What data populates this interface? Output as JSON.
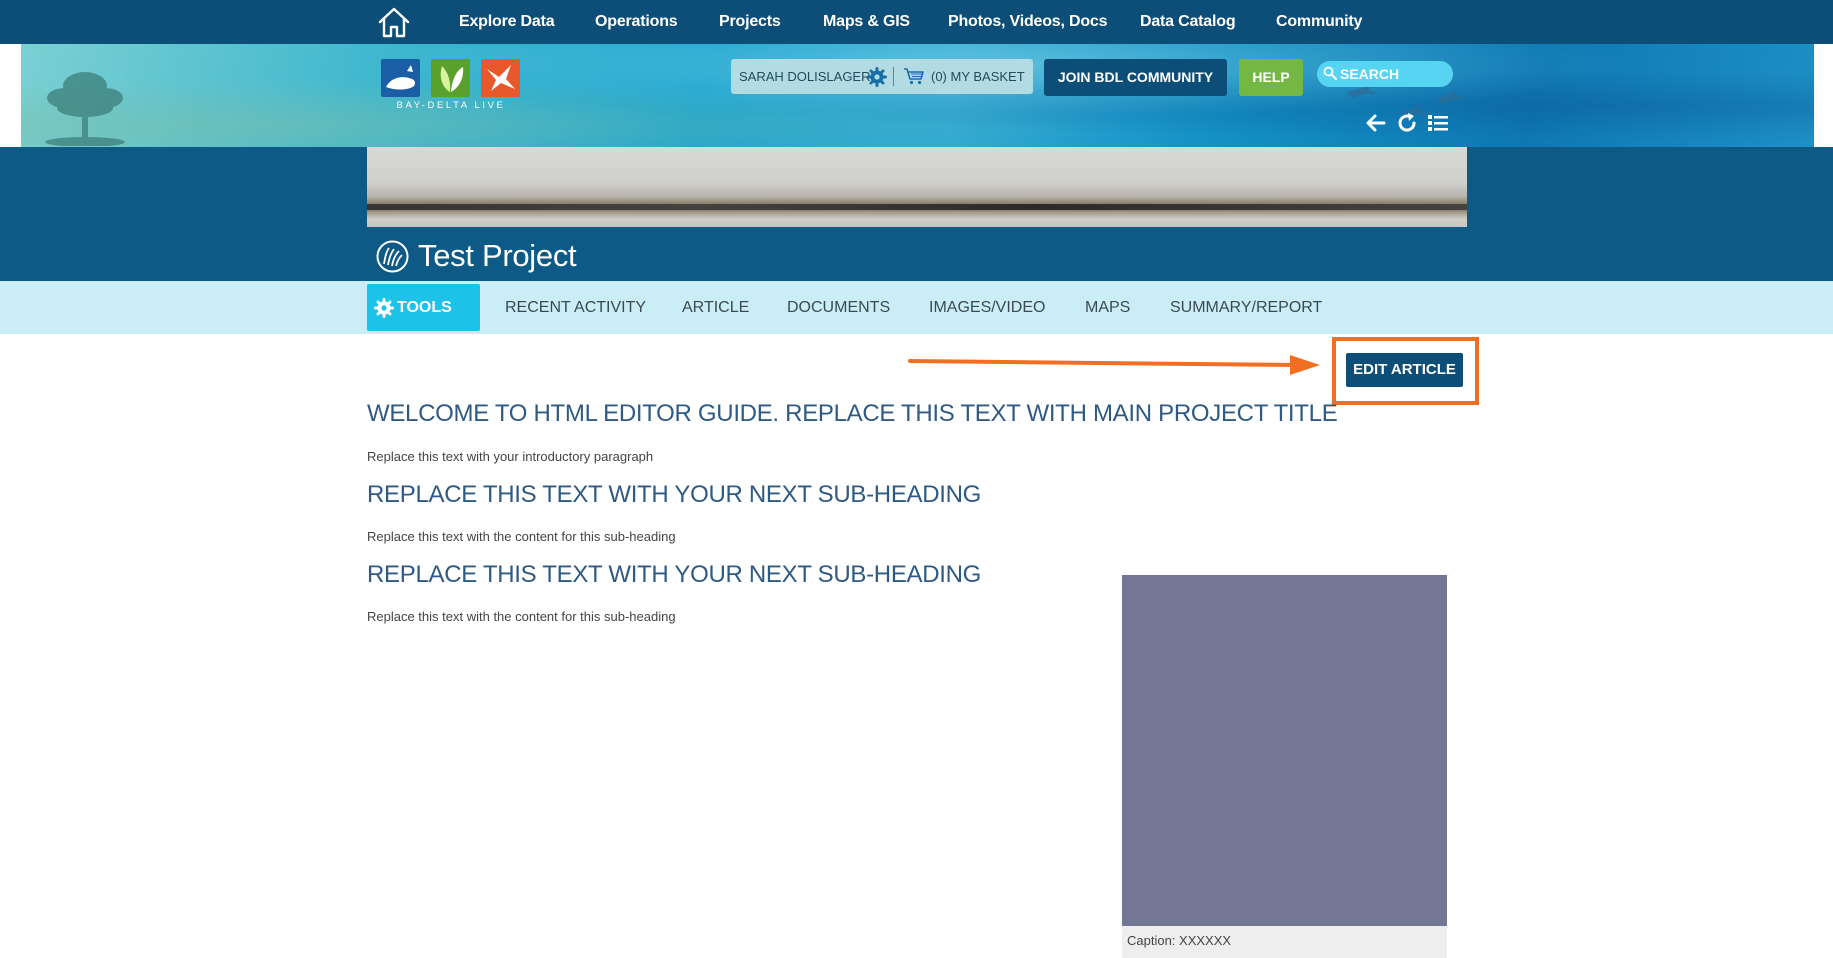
{
  "top_nav": {
    "home_icon": "home-icon",
    "links": [
      "Explore Data",
      "Operations",
      "Projects",
      "Maps & GIS",
      "Photos, Videos, Docs",
      "Data Catalog",
      "Community"
    ]
  },
  "header": {
    "logo_text": "BAY-DELTA LIVE",
    "logo_colors": [
      "#1a5fa6",
      "#5aa02c",
      "#e8582b"
    ],
    "user_name": "SARAH DOLISLAGER",
    "basket_label": "(0) MY BASKET",
    "join_label": "JOIN BDL COMMUNITY",
    "help_label": "HELP",
    "search_placeholder": "SEARCH",
    "tool_icons": [
      "back-arrow-icon",
      "refresh-icon",
      "list-icon"
    ]
  },
  "project": {
    "title": "Test Project",
    "icon": "water-wave-icon"
  },
  "tabs": {
    "tools_label": "TOOLS",
    "items": [
      "RECENT ACTIVITY",
      "ARTICLE",
      "DOCUMENTS",
      "IMAGES/VIDEO",
      "MAPS",
      "SUMMARY/REPORT"
    ]
  },
  "article": {
    "edit_label": "EDIT ARTICLE",
    "title": "WELCOME TO HTML EDITOR GUIDE. REPLACE THIS TEXT WITH MAIN PROJECT TITLE",
    "intro": "Replace this text with your introductory paragraph",
    "sections": [
      {
        "heading": "REPLACE THIS TEXT WITH YOUR NEXT SUB-HEADING",
        "body": "Replace this text with the content for this sub-heading"
      },
      {
        "heading": "REPLACE THIS TEXT WITH YOUR NEXT SUB-HEADING",
        "body": "Replace this text with the content for this sub-heading"
      }
    ],
    "image_caption": "Caption: XXXXXX"
  },
  "colors": {
    "nav_bg": "#0d4e78",
    "accent_orange": "#f26f21",
    "tools_blue": "#1cc2e8",
    "help_green": "#74b843",
    "heading_blue": "#2f5a83"
  }
}
